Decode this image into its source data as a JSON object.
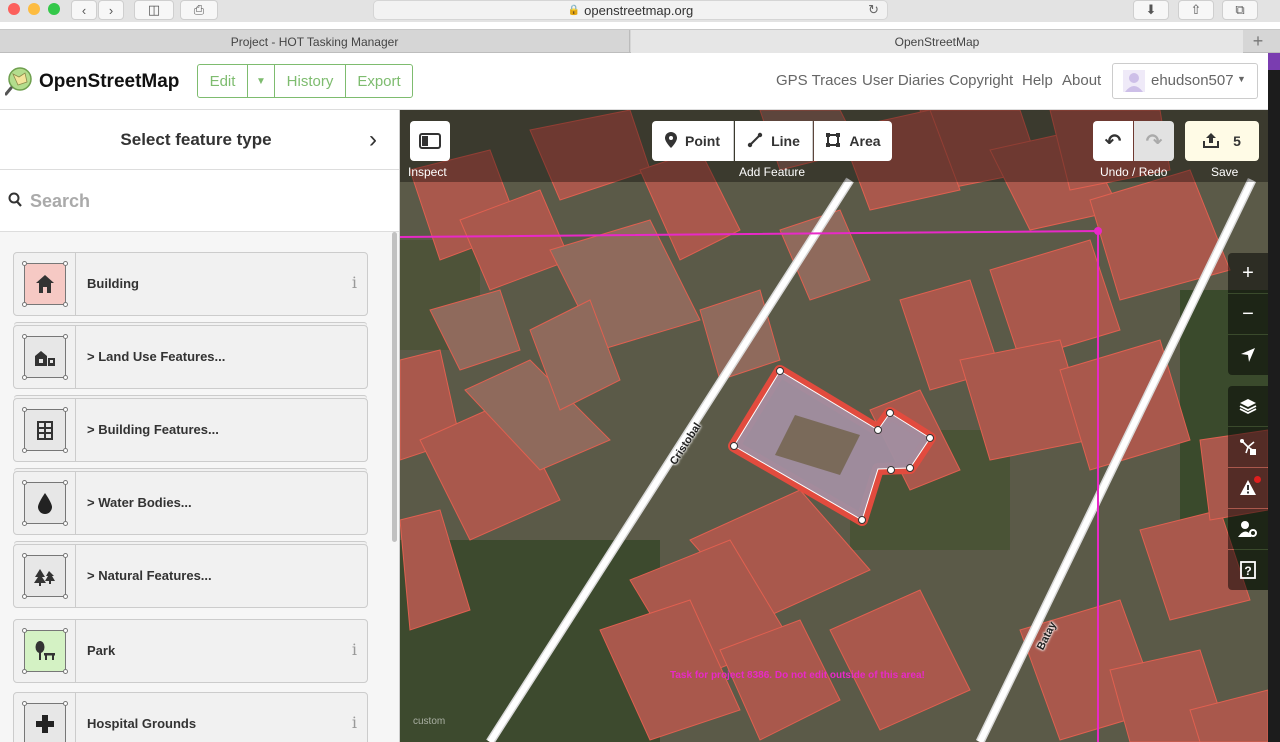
{
  "browser": {
    "url": "openstreetmap.org",
    "tabs": [
      {
        "label": "Project - HOT Tasking Manager",
        "active": false
      },
      {
        "label": "OpenStreetMap",
        "active": true
      }
    ],
    "new_tab": "+"
  },
  "header": {
    "brand": "OpenStreetMap",
    "edit_label": "Edit",
    "history_label": "History",
    "export_label": "Export",
    "nav": {
      "gps": "GPS Traces",
      "diaries": "User Diaries",
      "copyright": "Copyright",
      "help": "Help",
      "about": "About"
    },
    "username": "ehudson507",
    "accent_color": "#7ebc6f"
  },
  "sidebar": {
    "title": "Select feature type",
    "search_placeholder": "Search",
    "presets": [
      {
        "label": "Building",
        "info": "i",
        "icon": "building-icon"
      },
      {
        "label": "Land Use Features...",
        "icon": "landuse-icon"
      },
      {
        "label": "Building Features...",
        "icon": "building-features-icon"
      },
      {
        "label": "Water Bodies...",
        "icon": "water-drop-icon"
      },
      {
        "label": "Natural Features...",
        "icon": "natural-icon"
      },
      {
        "label": "Park",
        "info": "i",
        "icon": "park-icon"
      },
      {
        "label": "Hospital Grounds",
        "info": "i",
        "icon": "hospital-icon"
      }
    ]
  },
  "map": {
    "inspect_label": "Inspect",
    "point_label": "Point",
    "line_label": "Line",
    "area_label": "Area",
    "add_feature_label": "Add Feature",
    "undo_redo_label": "Undo / Redo",
    "save_label": "Save",
    "save_count": "5",
    "streets": [
      "Cristobal",
      "Batay"
    ],
    "task_note": "Task for project 8386. Do not edit outside of this area!",
    "imagery_label": "custom",
    "task_boundary_color": "#e829c8",
    "building_color": "#e06050"
  }
}
